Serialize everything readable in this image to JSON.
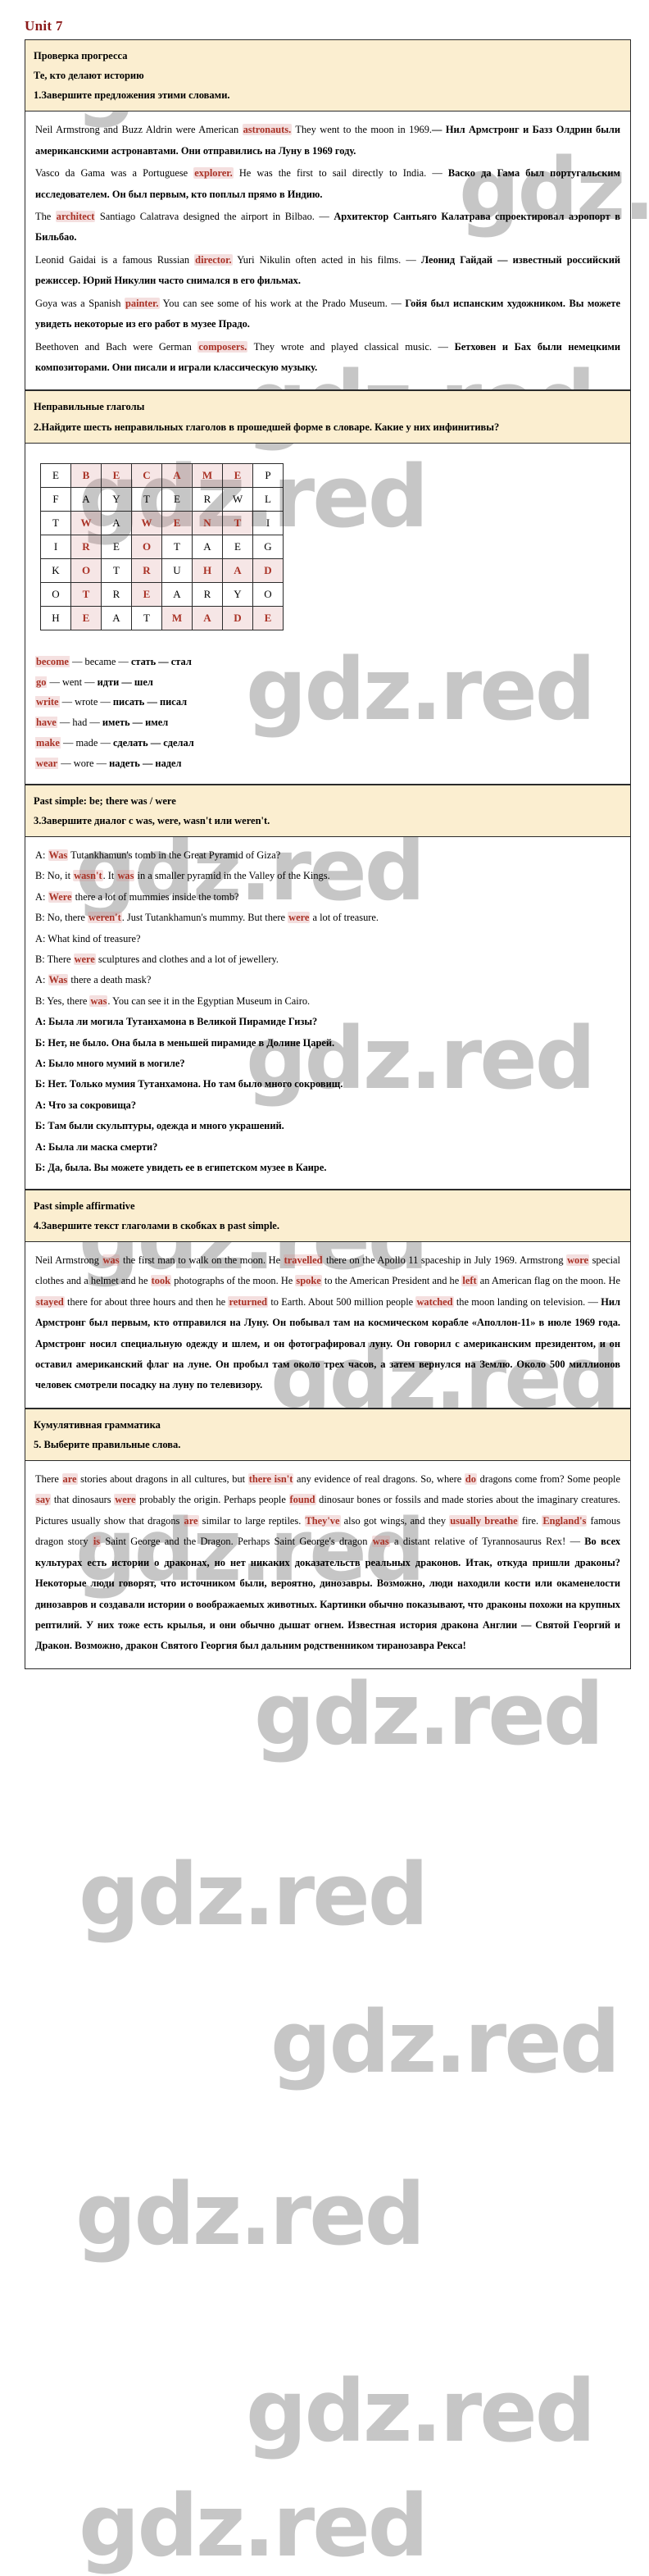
{
  "page": {
    "unit_title": "Unit 7",
    "watermark_text": "gdz.red",
    "accent_color": "#a93226",
    "panel_color": "#fbeed0"
  },
  "section1": {
    "heading": "Проверка прогресса",
    "subheading": " Те, кто делают историю",
    "task": "1.Завершите предложения этими словами.",
    "items": [
      {
        "en_pre": "Neil Armstrong and Buzz Aldrin were American ",
        "answer": "astronauts.",
        "en_post": " They went to the moon in 1969.",
        "ru": "— Нил Армстронг и Базз Олдрин были американскими астронавтами. Они отправились на Луну в 1969 году."
      },
      {
        "en_pre": "Vasco da Gama was a Portuguese ",
        "answer": "explorer.",
        "en_post": " He was the first to sail directly to India. — ",
        "ru": "Васко да Гама был португальским исследователем. Он был первым, кто поплыл прямо в Индию."
      },
      {
        "en_pre": "The ",
        "answer": "architect",
        "en_post": " Santiago Calatrava designed the airport in Bilbao. — ",
        "ru": "Архитектор Сантьяго Калатрава спроектировал аэропорт в Бильбао."
      },
      {
        "en_pre": "Leonid Gaidai is a famous Russian ",
        "answer": "director.",
        "en_post": " Yuri Nikulin often acted in his films. — ",
        "ru": "Леонид Гайдай —  известный российский режиссер. Юрий Никулин часто снимался в его фильмах."
      },
      {
        "en_pre": "Goya was a Spanish ",
        "answer": "painter.",
        "en_post": " You can see some of his work at the Prado Museum. — ",
        "ru": "Гойя был испанским художником. Вы можете увидеть некоторые из его работ в музее Прадо."
      },
      {
        "en_pre": "Beethoven and Bach were German ",
        "answer": "composers.",
        "en_post": " They wrote and played classical music. — ",
        "ru": "Бетховен и Бах были немецкими композиторами. Они писали и играли классическую музыку."
      }
    ]
  },
  "section2": {
    "heading": "Неправильные глаголы",
    "task": "2.Найдите шесть неправильных глаголов в прошедшей форме в словаре. Какие у них инфинитивы?",
    "grid": {
      "rows": 7,
      "cols": 8,
      "letters": [
        [
          "E",
          "B",
          "E",
          "C",
          "A",
          "M",
          "E",
          "P"
        ],
        [
          "F",
          "A",
          "Y",
          "T",
          "E",
          "R",
          "W",
          "L"
        ],
        [
          "T",
          "W",
          "A",
          "W",
          "E",
          "N",
          "T",
          "I"
        ],
        [
          "I",
          "R",
          "E",
          "O",
          "T",
          "A",
          "E",
          "G"
        ],
        [
          "K",
          "O",
          "T",
          "R",
          "U",
          "H",
          "A",
          "D"
        ],
        [
          "O",
          "T",
          "R",
          "E",
          "A",
          "R",
          "Y",
          "O"
        ],
        [
          "H",
          "E",
          "A",
          "T",
          "M",
          "A",
          "D",
          "E"
        ]
      ],
      "highlight": [
        [
          0,
          1
        ],
        [
          0,
          2
        ],
        [
          0,
          3
        ],
        [
          0,
          4
        ],
        [
          0,
          5
        ],
        [
          0,
          6
        ],
        [
          2,
          1
        ],
        [
          2,
          3
        ],
        [
          2,
          4
        ],
        [
          2,
          5
        ],
        [
          2,
          6
        ],
        [
          3,
          1
        ],
        [
          3,
          3
        ],
        [
          4,
          1
        ],
        [
          4,
          3
        ],
        [
          4,
          5
        ],
        [
          4,
          6
        ],
        [
          4,
          7
        ],
        [
          5,
          1
        ],
        [
          5,
          3
        ],
        [
          6,
          1
        ],
        [
          6,
          4
        ],
        [
          6,
          5
        ],
        [
          6,
          6
        ],
        [
          6,
          7
        ]
      ]
    },
    "verbs": [
      {
        "inf": "become",
        "past": " — became — ",
        "ru": "стать — стал"
      },
      {
        "inf": "go",
        "past": " — went — ",
        "ru": "идти — шел"
      },
      {
        "inf": "write",
        "past": " — wrote — ",
        "ru": "писать — писал"
      },
      {
        "inf": "have",
        "past": " — had — ",
        "ru": "иметь — имел"
      },
      {
        "inf": "make",
        "past": " — made — ",
        "ru": "сделать — сделал"
      },
      {
        "inf": "wear",
        "past": " — wore — ",
        "ru": "надеть — надел"
      }
    ]
  },
  "section3": {
    "heading": "Past simple: be; there was / were",
    "task": "3.Завершите диалог с was, were, wasn't или weren't.",
    "dialog": [
      {
        "pre": "A: ",
        "a1": "Was",
        "mid": " Tutankhamun's tomb in the Great Pyramid of Giza?",
        "a2": "",
        "post": ""
      },
      {
        "pre": "B: No, it ",
        "a1": "wasn't",
        "mid": ". It ",
        "a2": "was",
        "post": " in a smaller pyramid in the Valley of the Kings."
      },
      {
        "pre": "A: ",
        "a1": "Were",
        "mid": " there a lot of mummies inside the tomb?",
        "a2": "",
        "post": ""
      },
      {
        "pre": "B: No, there ",
        "a1": "weren't",
        "mid": ". Just Tutankhamun's mummy. But there ",
        "a2": "were",
        "post": " a lot of treasure."
      },
      {
        "pre": "A: What kind of treasure?",
        "a1": "",
        "mid": "",
        "a2": "",
        "post": ""
      },
      {
        "pre": "B: There ",
        "a1": "were",
        "mid": " sculptures and clothes and a lot of jewellery.",
        "a2": "",
        "post": ""
      },
      {
        "pre": "A: ",
        "a1": "Was",
        "mid": " there a death mask?",
        "a2": "",
        "post": ""
      },
      {
        "pre": "B: Yes, there ",
        "a1": "was",
        "mid": ". You can see it in the Egyptian Museum in Cairo.",
        "a2": "",
        "post": ""
      }
    ],
    "dialog_ru": [
      "А: Была ли могила Тутанхамона в Великой Пирамиде Гизы?",
      "Б: Нет, не было. Она была в меньшей пирамиде в Долине Царей.",
      "А: Было много мумий в могиле?",
      "Б: Нет. Только мумия Тутанхамона. Но там было много сокровищ.",
      "А: Что за сокровища?",
      "Б: Там были скульптуры, одежда и много украшений.",
      "А: Была ли маска смерти?",
      "Б: Да, была. Вы можете увидеть ее в египетском музее в Каире."
    ]
  },
  "section4": {
    "heading": "Past simple affirmative",
    "task": "4.Завершите текст глаголами в скобках в past simple.",
    "text_parts": [
      {
        "t": "Neil Armstrong ",
        "hl": false
      },
      {
        "t": "was",
        "hl": true
      },
      {
        "t": " the first man to walk on the moon. He ",
        "hl": false
      },
      {
        "t": "travelled",
        "hl": true
      },
      {
        "t": " there on the Apollo 11 spaceship in July 1969. Armstrong ",
        "hl": false
      },
      {
        "t": "wore",
        "hl": true
      },
      {
        "t": " special clothes and a helmet and he ",
        "hl": false
      },
      {
        "t": "took",
        "hl": true
      },
      {
        "t": " photographs of the moon. He ",
        "hl": false
      },
      {
        "t": "spoke",
        "hl": true
      },
      {
        "t": " to the American President and he ",
        "hl": false
      },
      {
        "t": "left",
        "hl": true
      },
      {
        "t": " an American flag on the moon. He ",
        "hl": false
      },
      {
        "t": "stayed",
        "hl": true
      },
      {
        "t": " there for about three hours and then he ",
        "hl": false
      },
      {
        "t": "returned",
        "hl": true
      },
      {
        "t": " to Earth. About 500 million people ",
        "hl": false
      },
      {
        "t": "watched",
        "hl": true
      },
      {
        "t": " the moon landing on television. — ",
        "hl": false
      }
    ],
    "ru": "Нил Армстронг был первым, кто отправился на Луну. Он побывал там на космическом корабле «Аполлон-11» в июле 1969 года. Армстронг носил специальную одежду и шлем, и он фотографировал луну. Он говорил с американским президентом, и он оставил американский флаг на луне. Он пробыл там около трех часов, а затем вернулся на Землю. Около 500 миллионов человек смотрели посадку на луну по телевизору."
  },
  "section5": {
    "heading": "Кумулятивная грамматика",
    "task": "5. Выберите правильные слова.",
    "text_parts": [
      {
        "t": "There ",
        "hl": false
      },
      {
        "t": "are",
        "hl": true
      },
      {
        "t": " stories about dragons in all cultures, but ",
        "hl": false
      },
      {
        "t": "there isn't",
        "hl": true
      },
      {
        "t": " any evidence of real dragons. So, where ",
        "hl": false
      },
      {
        "t": "do",
        "hl": true
      },
      {
        "t": " dragons come from? Some people ",
        "hl": false
      },
      {
        "t": "say",
        "hl": true
      },
      {
        "t": " that dinosaurs ",
        "hl": false
      },
      {
        "t": "were",
        "hl": true
      },
      {
        "t": " probably the origin. Perhaps people ",
        "hl": false
      },
      {
        "t": "found",
        "hl": true
      },
      {
        "t": " dinosaur bones or fossils and made stories about the imaginary creatures. Pictures usually show that dragons ",
        "hl": false
      },
      {
        "t": "are",
        "hl": true
      },
      {
        "t": " similar to large reptiles. ",
        "hl": false
      },
      {
        "t": "They've",
        "hl": true
      },
      {
        "t": " also got wings, and they ",
        "hl": false
      },
      {
        "t": "usually breathe",
        "hl": true
      },
      {
        "t": " fire. ",
        "hl": false
      },
      {
        "t": "England's",
        "hl": true
      },
      {
        "t": " famous dragon story ",
        "hl": false
      },
      {
        "t": "is",
        "hl": true
      },
      {
        "t": " Saint George and the Dragon. Perhaps Saint George's dragon ",
        "hl": false
      },
      {
        "t": "was",
        "hl": true
      },
      {
        "t": " a distant relative of Tyrannosaurus Rex! — ",
        "hl": false
      }
    ],
    "ru": "Во всех культурах есть истории о драконах, но нет никаких доказательств реальных драконов. Итак, откуда пришли драконы? Некоторые люди говорят, что источником были, вероятно, динозавры. Возможно, люди находили кости или окаменелости динозавров и создавали истории о воображаемых животных. Картинки обычно показывают, что драконы похожи на крупных рептилий. У них тоже есть крылья, и они обычно дышат огнем. Известная история дракона Англии — Святой Георгий и Дракон. Возможно, дракон Святого Георгия был дальним родственником тиранозавра Рекса!"
  }
}
